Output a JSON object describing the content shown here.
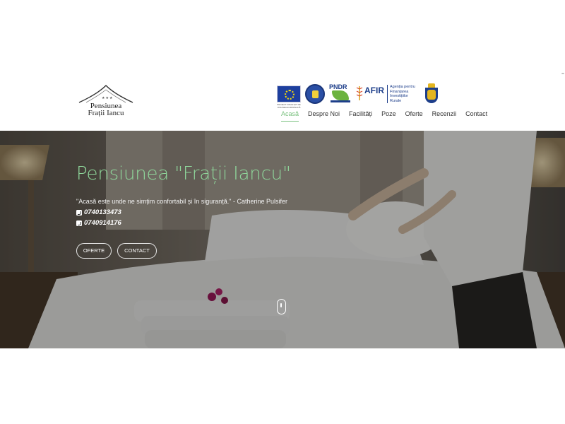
{
  "logo": {
    "stars": "★★★",
    "line1": "Pensiunea",
    "line2": "Frații Iancu"
  },
  "partners": {
    "eu_flag": "eu-flag-icon",
    "eu_caption": "PROIECT FINANȚAT DE UNIUNEA EUROPEANĂ",
    "gov_seal": "government-seal-icon",
    "pndr_text": "PNDR",
    "afir_title": "AFIR",
    "afir_desc": "Agenția pentru Finanțarea Investițiilor Rurale",
    "crest": "romania-coat-of-arms-icon"
  },
  "nav": {
    "items": [
      {
        "label": "Acasă",
        "active": true
      },
      {
        "label": "Despre Noi",
        "active": false
      },
      {
        "label": "Facilități",
        "active": false
      },
      {
        "label": "Poze",
        "active": false
      },
      {
        "label": "Oferte",
        "active": false
      },
      {
        "label": "Recenzii",
        "active": false
      },
      {
        "label": "Contact",
        "active": false
      }
    ]
  },
  "hero": {
    "title": "Pensiunea \"Frații Iancu\"",
    "quote": "\"Acasă este unde ne simțim confortabil și în siguranță.\" - Catherine Pulsifer",
    "phone1": "0740133473",
    "phone2": "0740914176",
    "btn_oferte": "OFERTE",
    "btn_contact": "CONTACT",
    "accent_color": "#8fd79b"
  },
  "colors": {
    "nav_active": "#7ac17f",
    "nav_text": "#333333"
  }
}
